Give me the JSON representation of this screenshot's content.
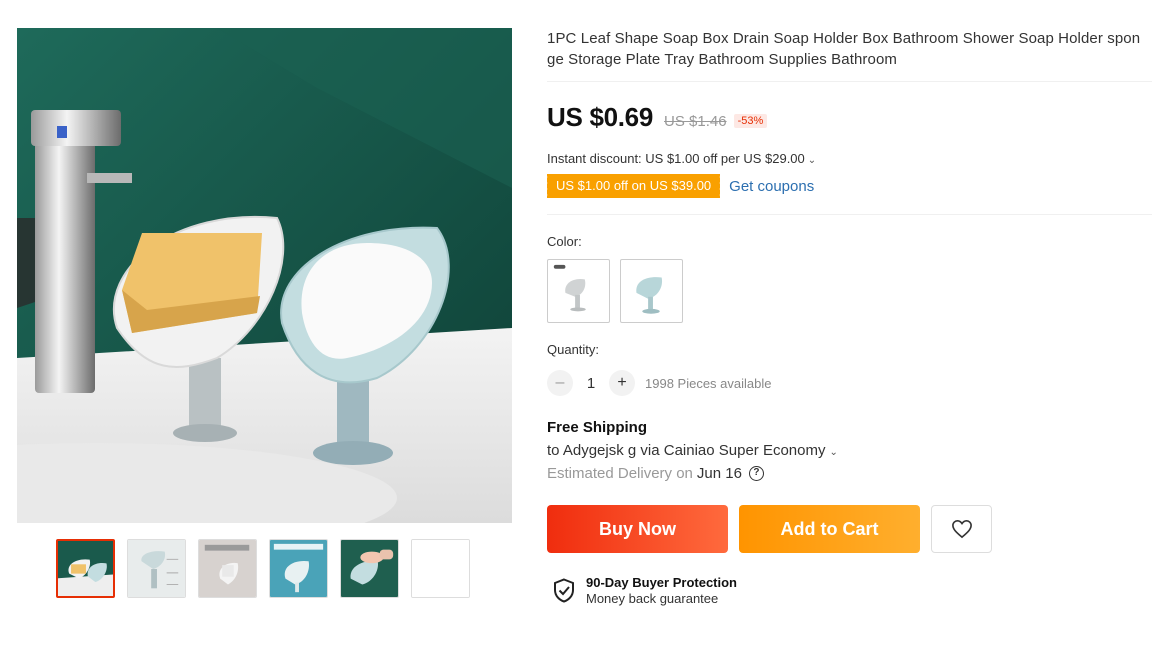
{
  "product": {
    "title": "1PC Leaf Shape Soap Box Drain Soap Holder Box Bathroom Shower Soap Holder sponge Storage Plate Tray Bathroom Supplies Bathroom"
  },
  "price": {
    "current": "US $0.69",
    "original": "US $1.46",
    "discount": "-53%"
  },
  "promotions": {
    "instant_discount": "Instant discount: US $1.00 off per US $29.00",
    "coupon": "US $1.00 off on US $39.00",
    "get_coupons": "Get coupons"
  },
  "color": {
    "label": "Color:",
    "options": [
      "grey-white",
      "light-blue"
    ]
  },
  "quantity": {
    "label": "Quantity:",
    "value": "1",
    "minus": "–",
    "plus": "+",
    "available": "1998 Pieces available"
  },
  "shipping": {
    "title": "Free Shipping",
    "route": "to Adygejsk g via Cainiao Super Economy",
    "eta_label": "Estimated Delivery on",
    "eta_date": "Jun 16",
    "help": "?"
  },
  "actions": {
    "buy_now": "Buy Now",
    "add_to_cart": "Add to Cart"
  },
  "protection": {
    "title": "90-Day Buyer Protection",
    "subtitle": "Money back guarantee"
  },
  "gallery": {
    "thumbnails": 6,
    "active_index": 0
  },
  "colors": {
    "accent": "#e62e04",
    "buy_now": "#f02d0e",
    "add_to_cart": "#ff9400",
    "coupon": "#f9a000",
    "link": "#2c6fb0"
  },
  "icons": {
    "help": "question-circle-icon",
    "wishlist": "heart-icon",
    "protection": "shield-check-icon",
    "chevron": "chevron-down-icon"
  }
}
